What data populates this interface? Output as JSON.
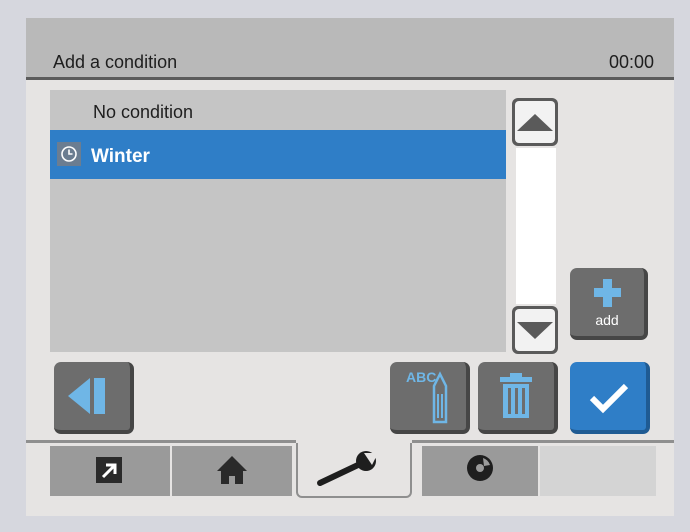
{
  "header": {
    "title": "Add a condition",
    "time": "00:00"
  },
  "conditions": [
    {
      "label": "No condition",
      "selected": false,
      "icon": ""
    },
    {
      "label": "Winter",
      "selected": true,
      "icon": "clock-icon"
    }
  ],
  "buttons": {
    "add_label": "add",
    "rename_icon_text": "ABC"
  },
  "tabs": [
    {
      "icon": "shortcut-arrow-icon",
      "active": false
    },
    {
      "icon": "home-icon",
      "active": false
    },
    {
      "icon": "wrench-icon",
      "active": true
    },
    {
      "icon": "disc-icon",
      "active": false
    },
    {
      "icon": "",
      "active": false
    }
  ],
  "colors": {
    "accent": "#2f7ec7",
    "header_bg": "#b9b9b9",
    "list_bg": "#c5c5c5",
    "button_grey": "#6d6d6d",
    "icon_light_blue": "#6fb6e6"
  }
}
